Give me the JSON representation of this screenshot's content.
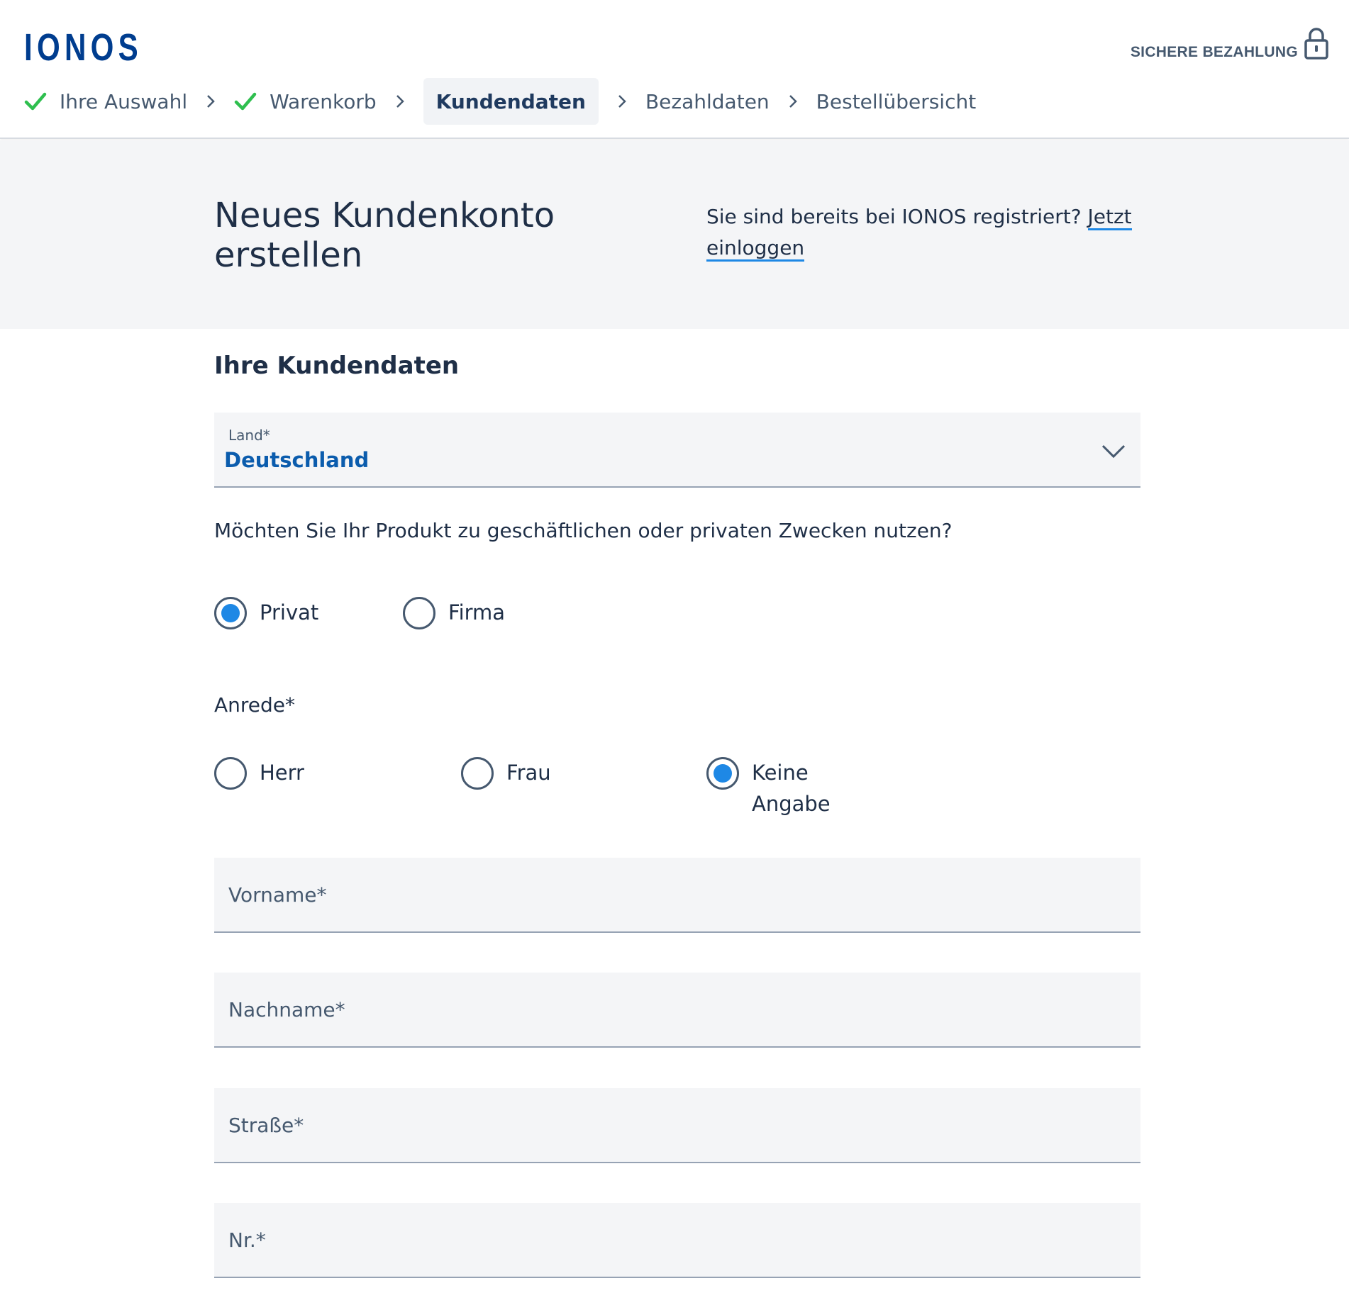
{
  "header": {
    "logo": "IONOS",
    "secure_label": "SICHERE BEZAHLUNG",
    "steps": [
      {
        "label": "Ihre Auswahl",
        "state": "done"
      },
      {
        "label": "Warenkorb",
        "state": "done"
      },
      {
        "label": "Kundendaten",
        "state": "active"
      },
      {
        "label": "Bezahldaten",
        "state": "todo"
      },
      {
        "label": "Bestellübersicht",
        "state": "todo"
      }
    ]
  },
  "banner": {
    "title": "Neues Kundenkonto erstellen",
    "login_prompt": "Sie sind bereits bei IONOS registriert?",
    "login_link": "Jetzt einloggen"
  },
  "form": {
    "section_title": "Ihre Kundendaten",
    "country": {
      "label": "Land*",
      "value": "Deutschland"
    },
    "usage_question": "Möchten Sie Ihr Produkt zu geschäftlichen oder privaten Zwecken nutzen?",
    "usage_options": [
      {
        "label": "Privat",
        "checked": true
      },
      {
        "label": "Firma",
        "checked": false
      }
    ],
    "salutation_label": "Anrede*",
    "salutation_options": [
      {
        "label": "Herr",
        "checked": false
      },
      {
        "label": "Frau",
        "checked": false
      },
      {
        "label": "Keine Angabe",
        "checked": true
      }
    ],
    "fields": {
      "firstname": {
        "placeholder": "Vorname*",
        "value": ""
      },
      "lastname": {
        "placeholder": "Nachname*",
        "value": ""
      },
      "street": {
        "placeholder": "Straße*",
        "value": ""
      },
      "number": {
        "placeholder": "Nr.*",
        "value": ""
      }
    }
  },
  "colors": {
    "brand": "#003d8f",
    "accent": "#1e88e5",
    "check": "#2fbf4f",
    "text": "#1f2f47",
    "muted": "#46596f",
    "band": "#f4f5f7"
  }
}
